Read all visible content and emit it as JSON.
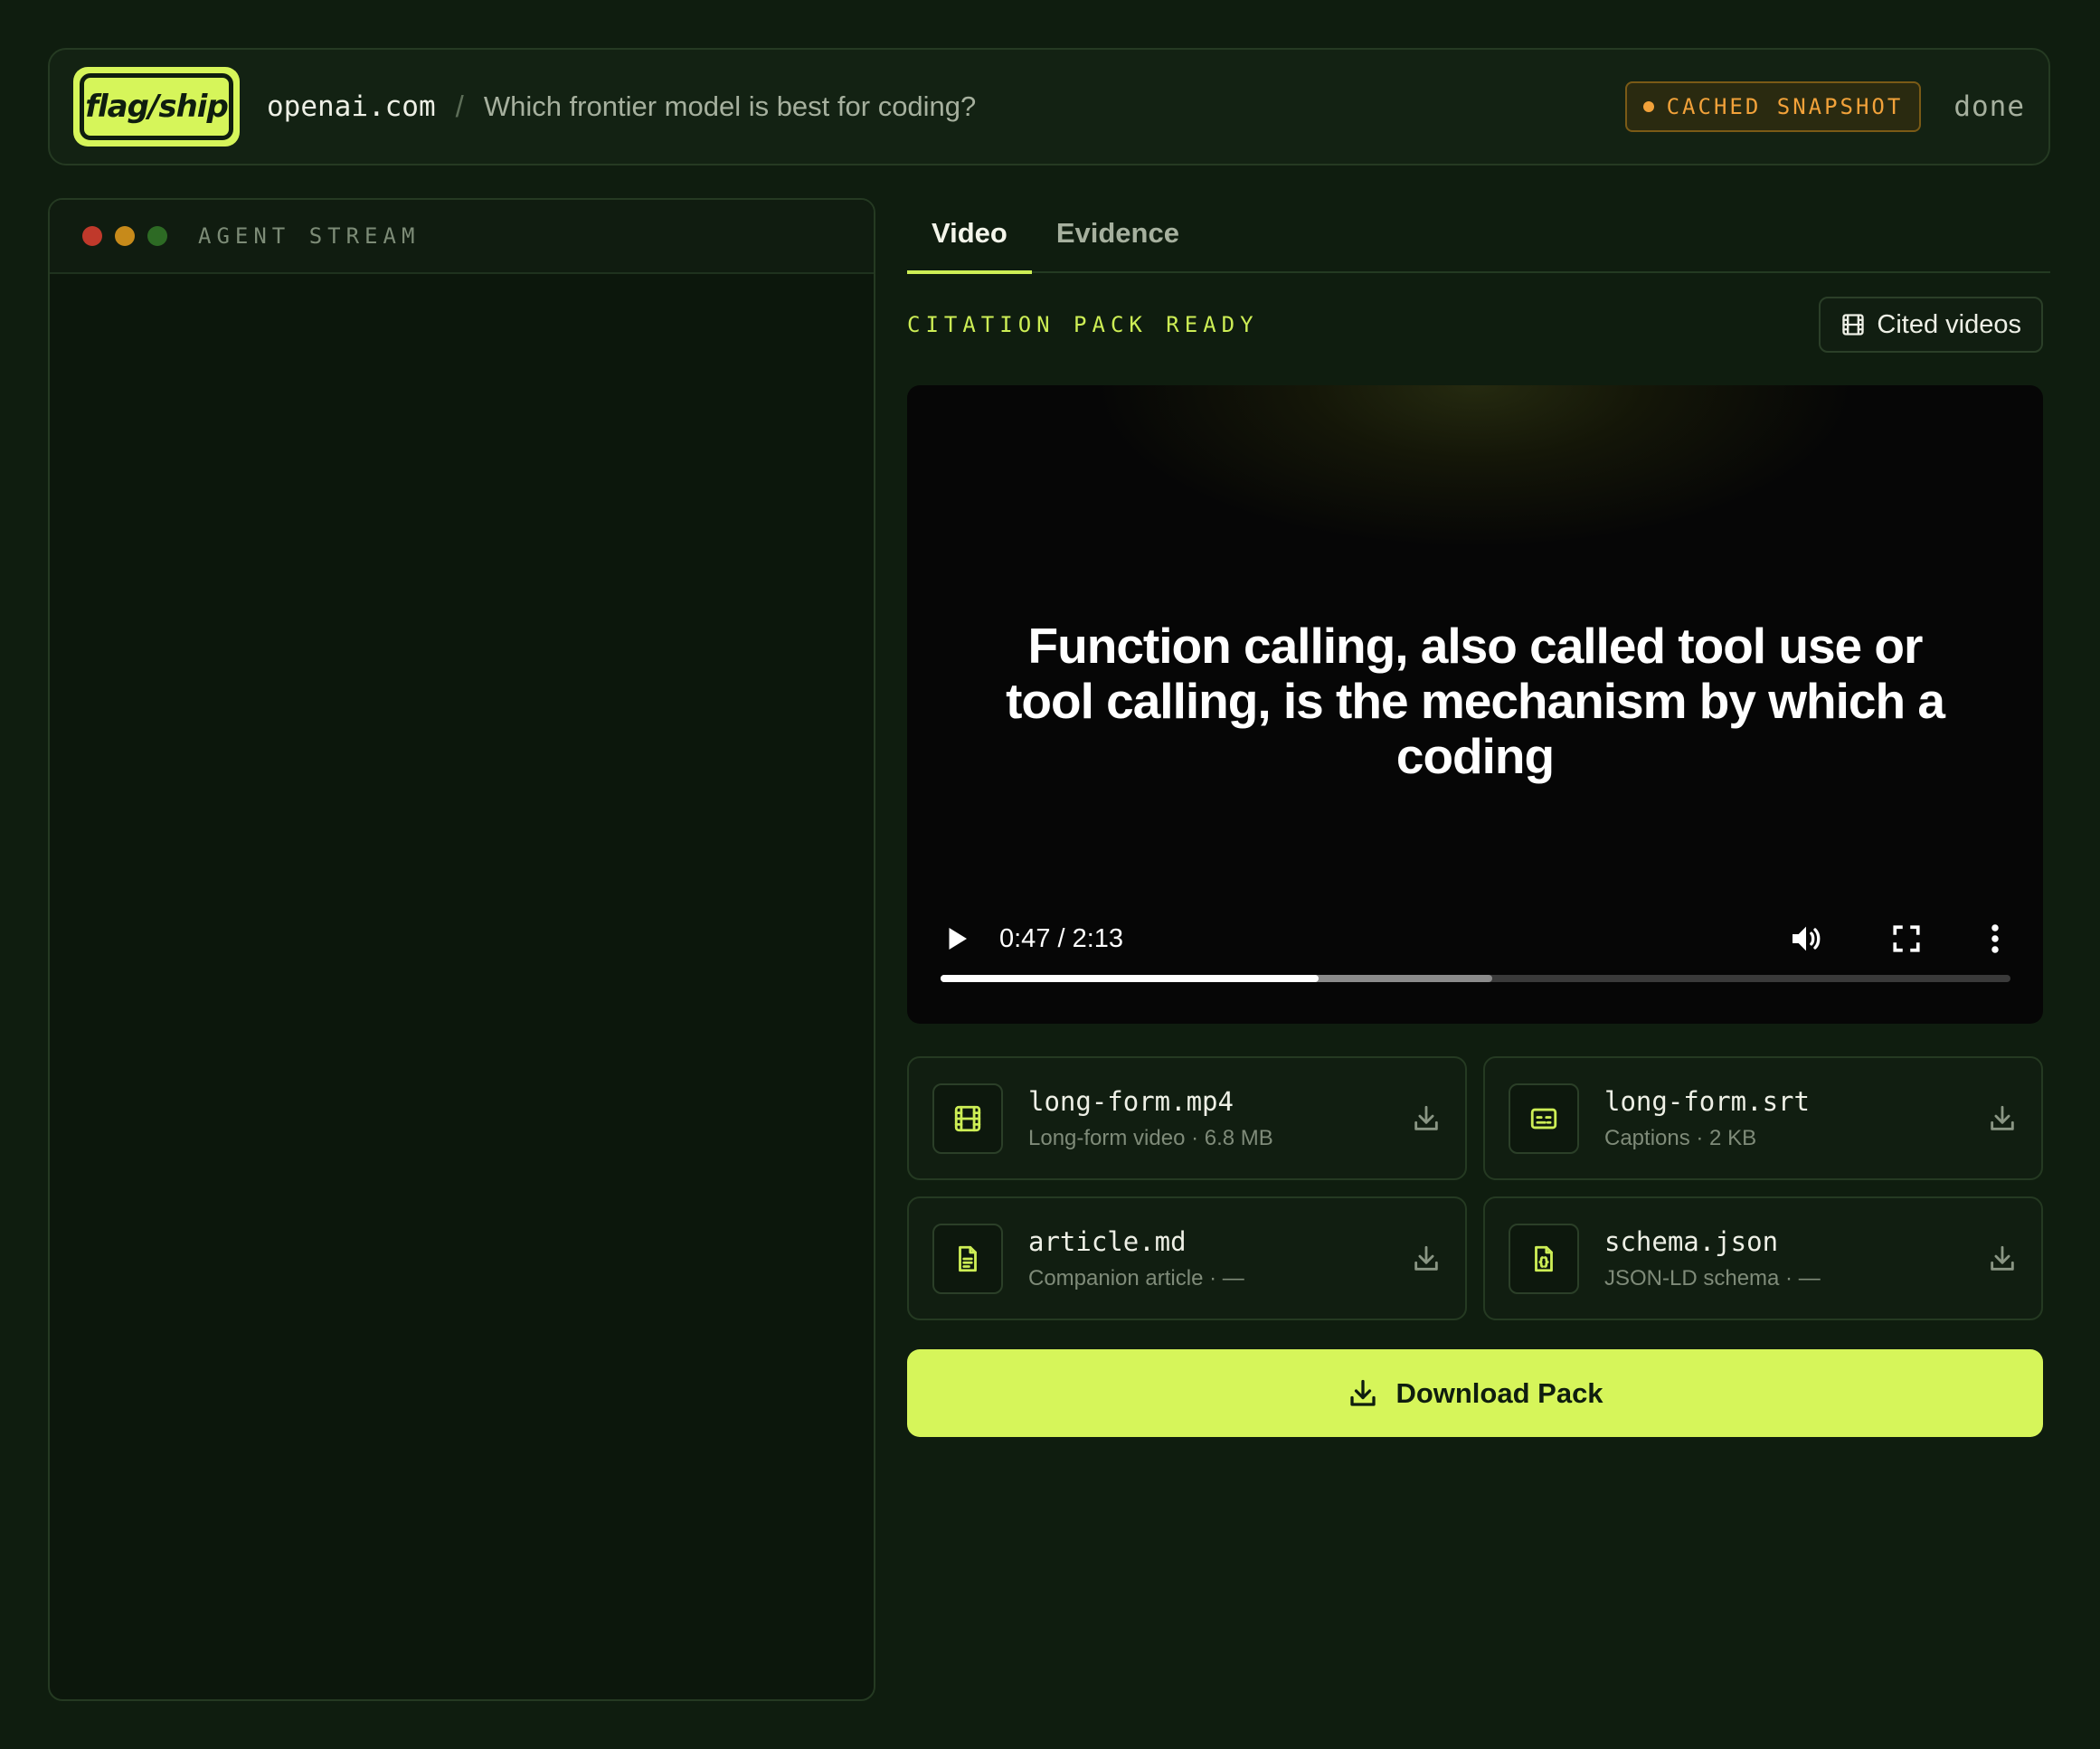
{
  "header": {
    "logo_text": "flag/ship",
    "domain": "openai.com",
    "separator": "/",
    "question": "Which frontier model is best for coding?",
    "badge_label": "CACHED SNAPSHOT",
    "status": "done"
  },
  "agent_stream": {
    "title": "AGENT STREAM"
  },
  "tabs": [
    {
      "label": "Video",
      "active": true
    },
    {
      "label": "Evidence",
      "active": false
    }
  ],
  "pack": {
    "status_label": "CITATION PACK READY",
    "cited_button_label": "Cited videos"
  },
  "video": {
    "caption": "Function calling, also called tool use or tool calling, is the mechanism by which a coding",
    "time_display": "0:47 / 2:13",
    "current_seconds": 47,
    "duration_seconds": 133,
    "buffered_fraction": 0.516
  },
  "files": [
    {
      "name": "long-form.mp4",
      "meta": "Long-form video · 6.8 MB",
      "icon": "film-icon"
    },
    {
      "name": "long-form.srt",
      "meta": "Captions · 2 KB",
      "icon": "captions-icon"
    },
    {
      "name": "article.md",
      "meta": "Companion article · —",
      "icon": "document-icon"
    },
    {
      "name": "schema.json",
      "meta": "JSON-LD schema · —",
      "icon": "json-file-icon"
    }
  ],
  "download_button_label": "Download Pack",
  "colors": {
    "background": "#0f1d0f",
    "accent": "#d6f55a",
    "badge": "#f2a23a"
  }
}
